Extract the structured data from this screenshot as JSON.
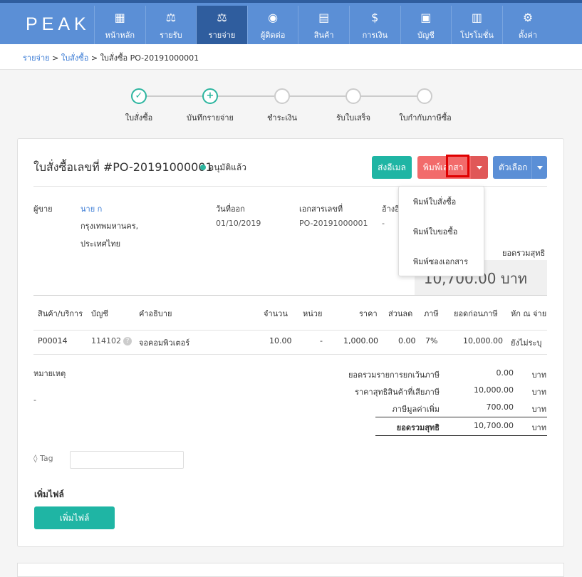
{
  "app": {
    "logo": "PEAK"
  },
  "nav": [
    {
      "label": "หน้าหลัก",
      "icon": "grid-icon"
    },
    {
      "label": "รายรับ",
      "icon": "scale-in-icon"
    },
    {
      "label": "รายจ่าย",
      "icon": "scale-out-icon"
    },
    {
      "label": "ผู้ติดต่อ",
      "icon": "user-icon"
    },
    {
      "label": "สินค้า",
      "icon": "boxes-icon"
    },
    {
      "label": "การเงิน",
      "icon": "money-bag-icon"
    },
    {
      "label": "บัญชี",
      "icon": "briefcase-icon"
    },
    {
      "label": "โปรโมชั่น",
      "icon": "gift-icon"
    },
    {
      "label": "ตั้งค่า",
      "icon": "gear-icon"
    }
  ],
  "breadcrumb": {
    "a": "รายจ่าย",
    "b": "ใบสั่งซื้อ",
    "c": "ใบสั่งซื้อ PO-20191000001",
    "sep": ">"
  },
  "steps": [
    {
      "label": "ใบสั่งซื้อ",
      "state": "done"
    },
    {
      "label": "บันทึกรายจ่าย",
      "state": "plus"
    },
    {
      "label": "ชำระเงิน",
      "state": "todo"
    },
    {
      "label": "รับใบเสร็จ",
      "state": "todo"
    },
    {
      "label": "ใบกำกับภาษีซื้อ",
      "state": "todo"
    }
  ],
  "doc": {
    "title": "ใบสั่งซื้อเลขที่ #PO-20191000001",
    "status": "อนุมัติแล้ว",
    "status_color": "#2cb59f"
  },
  "buttons": {
    "email": "ส่งอีเมล",
    "print": "พิมพ์เอกสา",
    "options": "ตัวเลือก",
    "add_file": "เพิ่มไฟล์"
  },
  "dropdown": [
    "พิมพ์ใบสั่งซื้อ",
    "พิมพ์ใบขอซื้อ",
    "พิมพ์ซองเอกสาร"
  ],
  "info": {
    "vendor_label": "ผู้ขาย",
    "vendor_name": "นาย ก",
    "vendor_addr1": "กรุงเทพมหานคร,",
    "vendor_addr2": "ประเทศไทย",
    "date_label": "วันที่ออก",
    "date": "01/10/2019",
    "docno_label": "เอกสารเลขที่",
    "docno": "PO-20191000001",
    "ref_label": "อ้างอิ",
    "ref": "-",
    "net_label": "ยอดรวมสุทธิ",
    "net_value": "10,700.00  บาท"
  },
  "table": {
    "headers": [
      "สินค้า/บริการ",
      "บัญชี",
      "คำอธิบาย",
      "จำนวน",
      "หน่วย",
      "ราคา",
      "ส่วนลด",
      "ภาษี",
      "ยอดก่อนภาษี",
      "หัก ณ จ่าย"
    ],
    "rows": [
      {
        "code": "P00014",
        "account": "114102",
        "desc": "จอคอมพิวเตอร์",
        "qty": "10.00",
        "unit": "-",
        "price": "1,000.00",
        "discount": "0.00",
        "tax": "7%",
        "pretax": "10,000.00",
        "wht": "ยังไม่ระบุ"
      }
    ]
  },
  "notes": {
    "label": "หมายเหตุ",
    "value": "-"
  },
  "summary": [
    {
      "label": "ยอดรวมรายการยกเว้นภาษี",
      "value": "0.00",
      "unit": "บาท"
    },
    {
      "label": "ราคาสุทธิสินค้าที่เสียภาษี",
      "value": "10,000.00",
      "unit": "บาท"
    },
    {
      "label": "ภาษีมูลค่าเพิ่ม",
      "value": "700.00",
      "unit": "บาท"
    },
    {
      "label": "ยอดรวมสุทธิ",
      "value": "10,700.00",
      "unit": "บาท"
    }
  ],
  "tag": {
    "label": "Tag",
    "placeholder": ""
  },
  "attach": {
    "label": "เพิ่มไฟล์"
  }
}
